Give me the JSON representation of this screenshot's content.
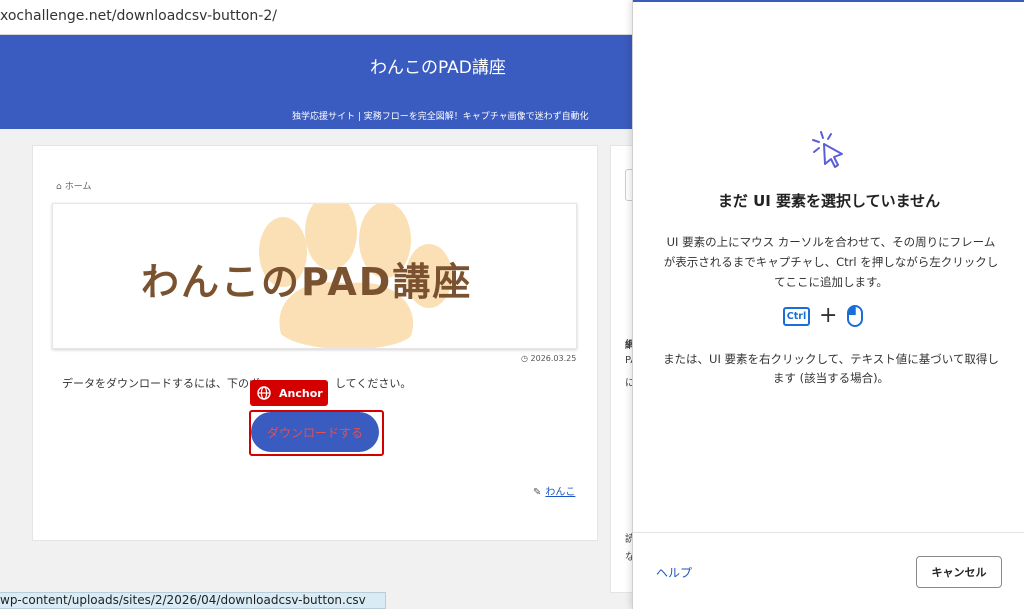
{
  "browser": {
    "url": "xochallenge.net/downloadcsv-button-2/",
    "status_url": "wp-content/uploads/sites/2/2026/04/downloadcsv-button.csv"
  },
  "site": {
    "title": "わんこのPAD講座",
    "tagline": "独学応援サイト | 実務フローを完全図解！キャプチャ画像で迷わず自動化",
    "accent_color": "#3a5bbf"
  },
  "article": {
    "breadcrumb_home": "ホーム",
    "hero_text": "わんこのPAD講座",
    "date": "2026.03.25",
    "intro_visible_left": "データをダウンロードするには、下のボ",
    "intro_visible_right": "してください。",
    "download_button_label": "ダウンロードする",
    "author": "わんこ"
  },
  "sidebar": {
    "fragments": [
      "網",
      "PA",
      "に",
      "読",
      "な"
    ]
  },
  "overlay": {
    "anchor_label": "Anchor",
    "highlight_color": "#d40000"
  },
  "panel": {
    "title": "まだ UI 要素を選択していません",
    "description": "UI 要素の上にマウス カーソルを合わせて、その周りにフレームが表示されるまでキャプチャし、Ctrl を押しながら左クリックしてここに追加します。",
    "ctrl_key": "Ctrl",
    "plus": "+",
    "description2": "または、UI 要素を右クリックして、テキスト値に基づいて取得します (該当する場合)。",
    "help_label": "ヘルプ",
    "cancel_label": "キャンセル",
    "icons": [
      "cursor-click-icon",
      "mouse-left-click-icon"
    ]
  }
}
